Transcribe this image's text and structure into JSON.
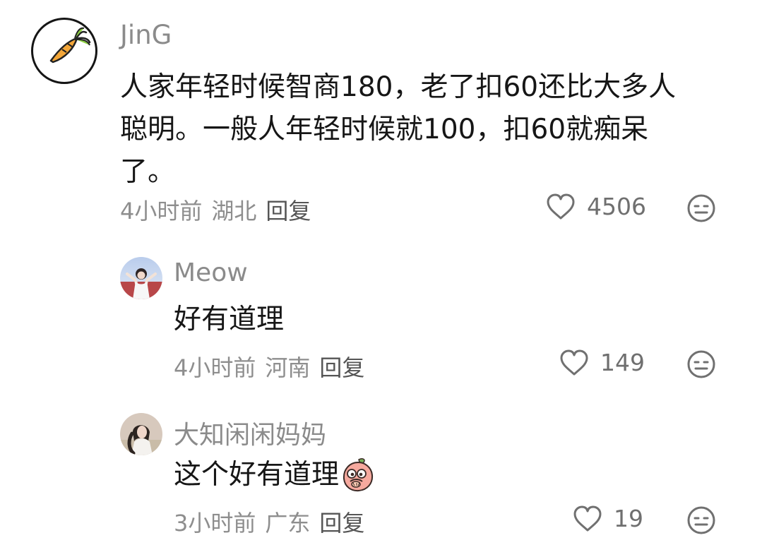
{
  "comments": [
    {
      "username": "JinG",
      "content": "人家年轻时候智商180，老了扣60还比大多人聪明。一般人年轻时候就100，扣60就痴呆了。",
      "time": "4小时前",
      "location": "湖北",
      "reply_label": "回复",
      "likes": "4506",
      "avatar_icon": "carrot-icon"
    },
    {
      "username": "Meow",
      "content": "好有道理",
      "time": "4小时前",
      "location": "河南",
      "reply_label": "回复",
      "likes": "149",
      "avatar_icon": "user-avatar-photo"
    },
    {
      "username": "大知闲闲妈妈",
      "content": "这个好有道理",
      "time": "3小时前",
      "location": "广东",
      "reply_label": "回复",
      "likes": "19",
      "avatar_icon": "user-avatar-photo",
      "emoji_icon": "peach-sticker-icon"
    }
  ],
  "icons": {
    "like": "heart-icon",
    "dislike": "emoji-face-icon"
  },
  "colors": {
    "text": "#161616",
    "secondary": "#8e8e8e",
    "reply": "#555555",
    "icon": "#6f6f6f"
  }
}
